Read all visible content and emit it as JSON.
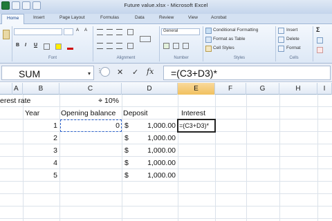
{
  "window": {
    "title": "Future value.xlsx  -  Microsoft Excel"
  },
  "ribbon_tabs": [
    "Home",
    "Insert",
    "Page Layout",
    "Formulas",
    "Data",
    "Review",
    "View",
    "Acrobat"
  ],
  "ribbon": {
    "font_group_label": "Font",
    "alignment_group_label": "Alignment",
    "number_group_label": "Number",
    "styles_group_label": "Styles",
    "cells_group_label": "Cells",
    "number_format": "General",
    "conditional_formatting": "Conditional Formatting",
    "format_as_table": "Format as Table",
    "cell_styles": "Cell Styles",
    "insert": "Insert",
    "delete": "Delete",
    "format": "Format",
    "bold": "B",
    "italic": "I",
    "underline": "U",
    "sigma": "Σ"
  },
  "formula_bar": {
    "name_box": "SUM",
    "formula": "=(C3+D3)*"
  },
  "columns": [
    "A",
    "B",
    "C",
    "D",
    "E",
    "F",
    "G",
    "H",
    "I"
  ],
  "cells": {
    "a1": "erest rate",
    "c1": "10%",
    "b2": "Year",
    "c2": "Opening balance",
    "d2": "Deposit",
    "e2": "Interest",
    "b3": "1",
    "c3": "0",
    "d3_sym": "$",
    "d3": "1,000.00",
    "e3": "=(C3+D3)*",
    "b4": "2",
    "d4_sym": "$",
    "d4": "1,000.00",
    "b5": "3",
    "d5_sym": "$",
    "d5": "1,000.00",
    "b6": "4",
    "d6_sym": "$",
    "d6": "1,000.00",
    "b7": "5",
    "d7_sym": "$",
    "d7": "1,000.00"
  },
  "colors": {
    "ribbon_bg": "#dde8f6",
    "selected_header": "#f1c15f",
    "formula_ref_border": "#3366cc"
  }
}
